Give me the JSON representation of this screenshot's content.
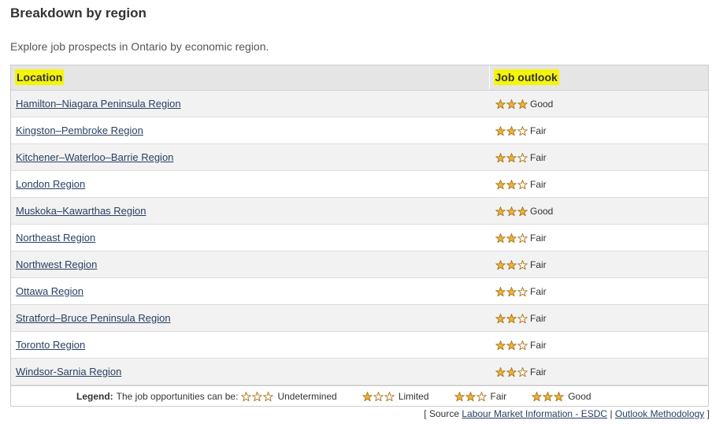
{
  "heading": "Breakdown by region",
  "intro": "Explore job prospects in Ontario by economic region.",
  "table": {
    "headers": {
      "location": "Location",
      "outlook": "Job outlook"
    },
    "rows": [
      {
        "location": "Hamilton–Niagara Peninsula Region",
        "outlook": "Good",
        "stars": 3
      },
      {
        "location": "Kingston–Pembroke Region",
        "outlook": "Fair",
        "stars": 2
      },
      {
        "location": "Kitchener–Waterloo–Barrie Region",
        "outlook": "Fair",
        "stars": 2
      },
      {
        "location": "London Region",
        "outlook": "Fair",
        "stars": 2
      },
      {
        "location": "Muskoka–Kawarthas Region",
        "outlook": "Good",
        "stars": 3
      },
      {
        "location": "Northeast Region",
        "outlook": "Fair",
        "stars": 2
      },
      {
        "location": "Northwest Region",
        "outlook": "Fair",
        "stars": 2
      },
      {
        "location": "Ottawa Region",
        "outlook": "Fair",
        "stars": 2
      },
      {
        "location": "Stratford–Bruce Peninsula Region",
        "outlook": "Fair",
        "stars": 2
      },
      {
        "location": "Toronto Region",
        "outlook": "Fair",
        "stars": 2
      },
      {
        "location": "Windsor-Sarnia Region",
        "outlook": "Fair",
        "stars": 2
      }
    ]
  },
  "legend": {
    "label": "Legend:",
    "text": "The job opportunities can be:",
    "items": [
      {
        "label": "Undetermined",
        "stars": 0
      },
      {
        "label": "Limited",
        "stars": 1
      },
      {
        "label": "Fair",
        "stars": 2
      },
      {
        "label": "Good",
        "stars": 3
      }
    ]
  },
  "source": {
    "open": "[ Source",
    "link1": "Labour Market Information - ESDC",
    "sep": "|",
    "link2": "Outlook Methodology",
    "close": "]"
  },
  "colors": {
    "star_fill": "#f0b33a",
    "star_stroke": "#a8741a",
    "link": "#284162",
    "highlight": "#f5f50a"
  }
}
